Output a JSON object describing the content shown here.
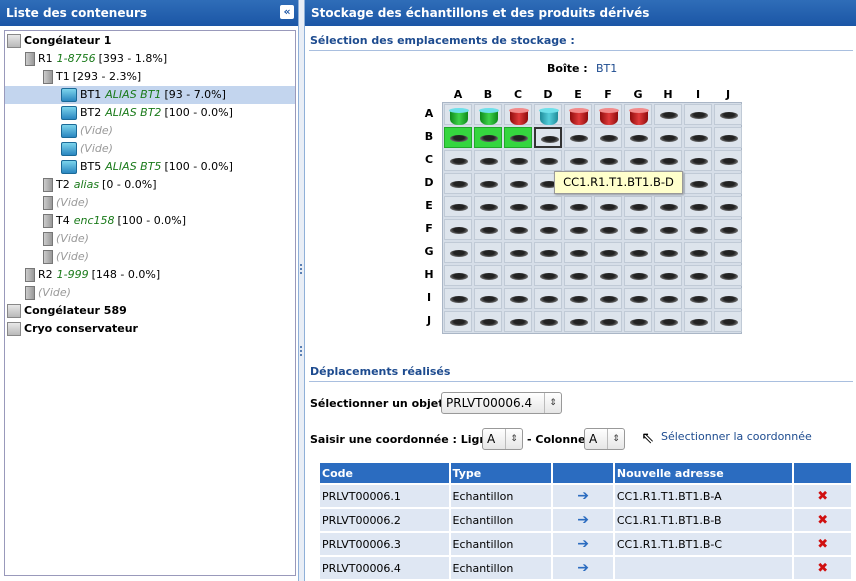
{
  "left_panel": {
    "title": "Liste des conteneurs",
    "collapse_icon": "double-chevron-left-icon"
  },
  "tree": [
    {
      "text": "Congélateur 1",
      "alias": "",
      "extra": "",
      "kind": "freezer",
      "bold": true
    },
    {
      "text": "R1",
      "alias": "1-8756",
      "extra": "[393 - 1.8%]",
      "kind": "rack"
    },
    {
      "text": "T1",
      "alias": "",
      "extra": "[293 - 2.3%]",
      "kind": "rack"
    },
    {
      "text": "BT1",
      "alias": "ALIAS BT1",
      "extra": "[93 - 7.0%]",
      "kind": "box"
    },
    {
      "text": "BT2",
      "alias": "ALIAS BT2",
      "extra": "[100 - 0.0%]",
      "kind": "box"
    },
    {
      "text": "(Vide)",
      "alias": "",
      "extra": "",
      "kind": "box-empty"
    },
    {
      "text": "(Vide)",
      "alias": "",
      "extra": "",
      "kind": "box-empty"
    },
    {
      "text": "BT5",
      "alias": "ALIAS BT5",
      "extra": "[100 - 0.0%]",
      "kind": "box"
    },
    {
      "text": "T2",
      "alias": "alias",
      "extra": "[0 - 0.0%]",
      "kind": "rack"
    },
    {
      "text": "(Vide)",
      "alias": "",
      "extra": "",
      "kind": "rack-empty"
    },
    {
      "text": "T4",
      "alias": "enc158",
      "extra": "[100 - 0.0%]",
      "kind": "rack"
    },
    {
      "text": "(Vide)",
      "alias": "",
      "extra": "",
      "kind": "rack-empty"
    },
    {
      "text": "(Vide)",
      "alias": "",
      "extra": "",
      "kind": "rack-empty"
    },
    {
      "text": "R2",
      "alias": "1-999",
      "extra": "[148 - 0.0%]",
      "kind": "rack"
    },
    {
      "text": "(Vide)",
      "alias": "",
      "extra": "",
      "kind": "rack-empty"
    },
    {
      "text": "Congélateur 589",
      "alias": "",
      "extra": "",
      "kind": "freezer",
      "bold": true
    },
    {
      "text": "Cryo conservateur",
      "alias": "",
      "extra": "",
      "kind": "freezer",
      "bold": true
    }
  ],
  "right_panel": {
    "title": "Stockage des échantillons et des produits dérivés",
    "selection_title": "Sélection des emplacements de stockage :",
    "box_label": "Boîte :",
    "box_value": "BT1",
    "col_labels": [
      "A",
      "B",
      "C",
      "D",
      "E",
      "F",
      "G",
      "H",
      "I",
      "J"
    ],
    "row_labels": [
      "A",
      "B",
      "C",
      "D",
      "E",
      "F",
      "G",
      "H",
      "I",
      "J"
    ],
    "tubes_row_a": [
      "green",
      "green",
      "red",
      "teal-red",
      "red",
      "red",
      "red",
      "",
      "",
      ""
    ],
    "green_cells_row_b": [
      "A",
      "B",
      "C"
    ],
    "selected_cell": "B-D",
    "tooltip": "CC1.R1.T1.BT1.B-D",
    "moves_title": "Déplacements réalisés",
    "select_object_label": "Sélectionner un objet :",
    "select_object_value": "PRLVT00006.4",
    "coord_label": "Saisir une coordonnée : Ligne",
    "coord_line_value": "A",
    "coord_col_label": "- Colonne",
    "coord_col_value": "A",
    "select_coord_link": "Sélectionner la coordonnée",
    "table_headers": [
      "Code",
      "Type",
      "",
      "Nouvelle adresse",
      ""
    ],
    "rows": [
      {
        "code": "PRLVT00006.1",
        "type": "Echantillon",
        "addr": "CC1.R1.T1.BT1.B-A"
      },
      {
        "code": "PRLVT00006.2",
        "type": "Echantillon",
        "addr": "CC1.R1.T1.BT1.B-B"
      },
      {
        "code": "PRLVT00006.3",
        "type": "Echantillon",
        "addr": "CC1.R1.T1.BT1.B-C"
      },
      {
        "code": "PRLVT00006.4",
        "type": "Echantillon",
        "addr": ""
      }
    ],
    "colors": {
      "header_blue": "#2b6cc0",
      "cell_green": "#35d63f",
      "tooltip_bg": "#ffffcc"
    }
  }
}
